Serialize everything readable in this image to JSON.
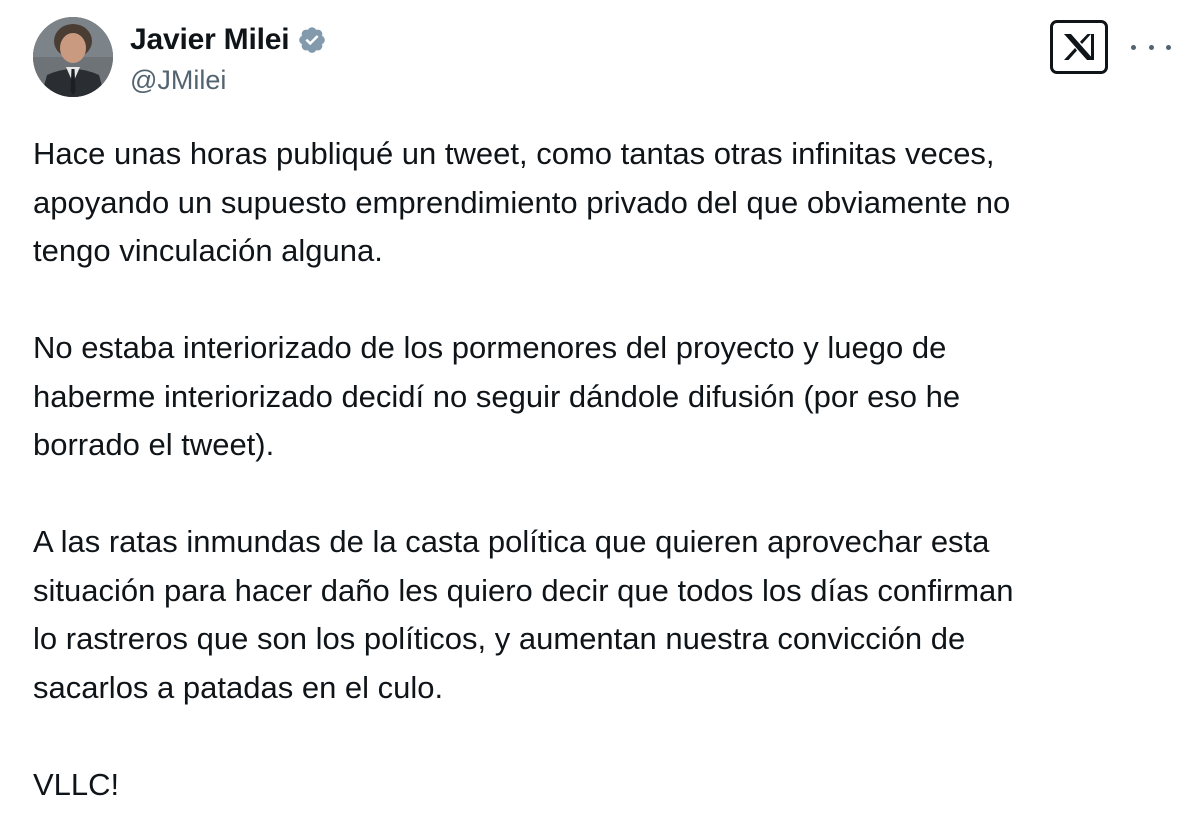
{
  "author": {
    "display_name": "Javier Milei",
    "handle": "@JMilei",
    "verified": true,
    "verified_icon": "verified-badge-icon",
    "avatar": "profile-photo"
  },
  "header": {
    "logo_icon": "x-logo-icon",
    "more_icon": "more-options-icon"
  },
  "tweet": {
    "paragraphs": [
      [
        "Hace unas horas publiqué un tweet, como tantas otras infinitas veces,",
        "apoyando un supuesto emprendimiento privado del que obviamente no",
        "tengo vinculación alguna."
      ],
      [
        "No estaba interiorizado de los pormenores del proyecto y luego de",
        "haberme interiorizado decidí no seguir dándole difusión (por eso he",
        "borrado el tweet)."
      ],
      [
        "A las ratas inmundas de la casta política que quieren aprovechar esta",
        "situación para hacer daño les quiero decir que todos los días confirman",
        "lo rastreros que son los políticos, y aumentan nuestra convicción de",
        "sacarlos a patadas en el culo."
      ],
      [
        "VLLC!"
      ]
    ]
  },
  "colors": {
    "text": "#0f1419",
    "secondary": "#536471",
    "verified_badge": "#829aab",
    "background": "#ffffff"
  }
}
